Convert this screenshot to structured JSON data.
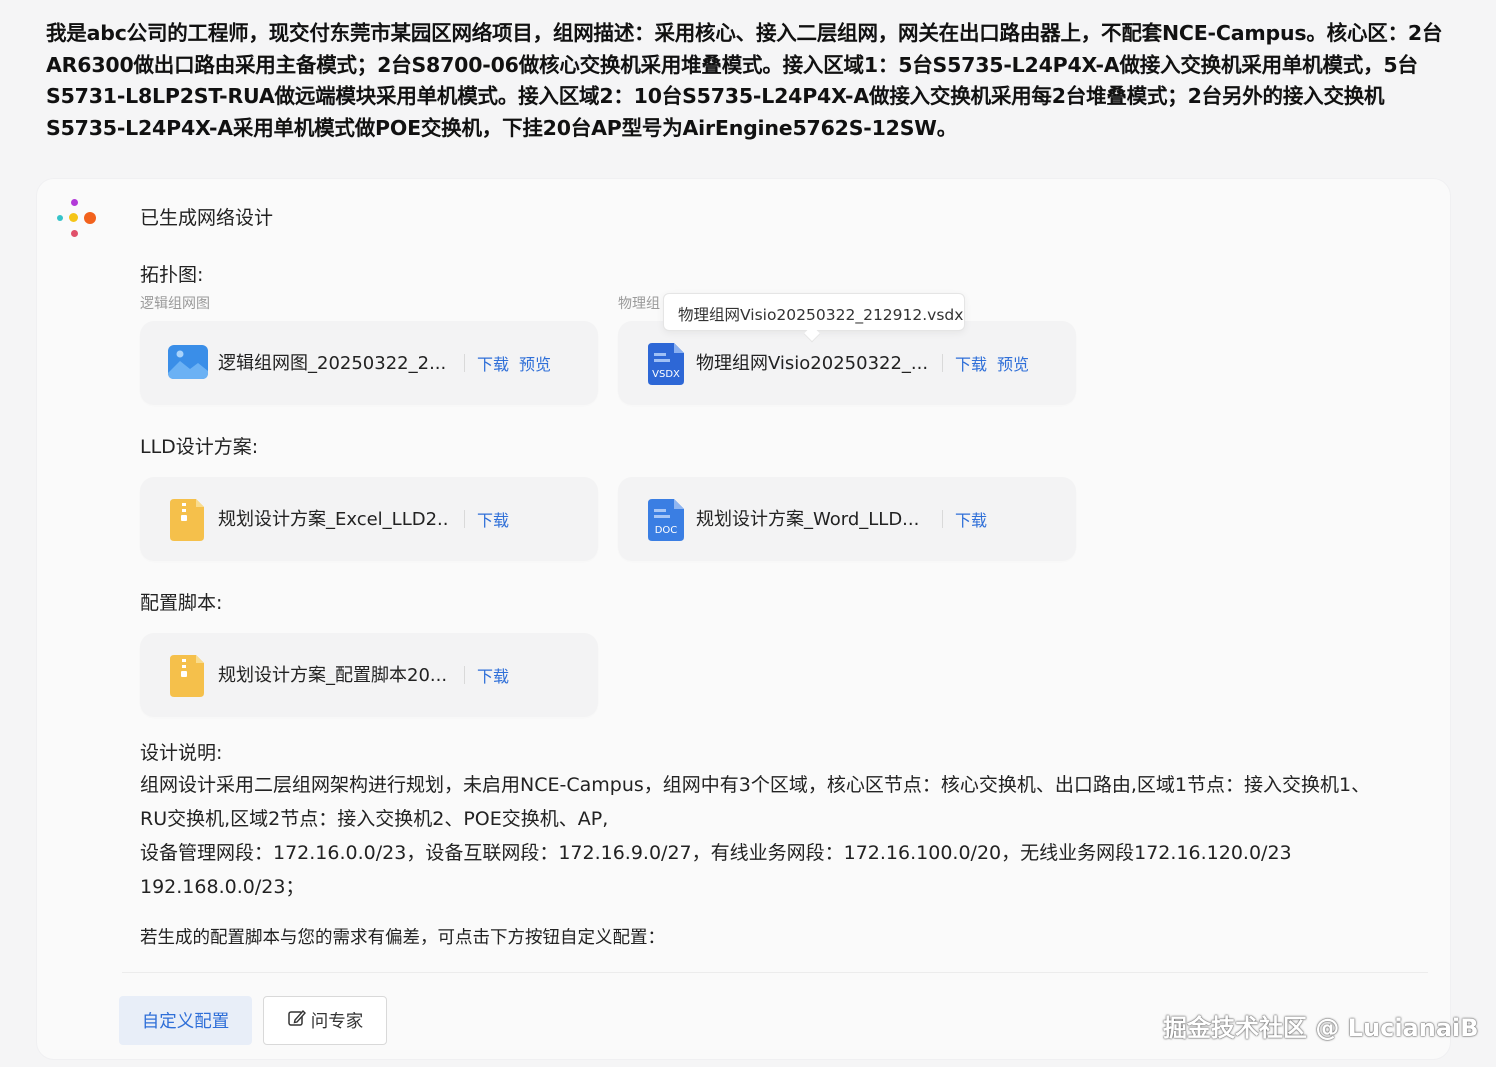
{
  "prompt": "我是abc公司的工程师，现交付东莞市某园区网络项目，组网描述：采用核心、接入二层组网，网关在出口路由器上，不配套NCE-Campus。核心区：2台AR6300做出口路由采用主备模式；2台S8700-06做核心交换机采用堆叠模式。接入区域1：5台S5735-L24P4X-A做接入交换机采用单机模式，5台S5731-L8LP2ST-RUA做远端模块采用单机模式。接入区域2：10台S5735-L24P4X-A做接入交换机采用每2台堆叠模式；2台另外的接入交换机S5735-L24P4X-A采用单机模式做POE交换机，下挂20台AP型号为AirEngine5762S-12SW。",
  "response": {
    "heading": "已生成网络设计",
    "topology": {
      "label": "拓扑图:",
      "logical_sub": "逻辑组网图",
      "physical_sub": "物理组",
      "files": [
        {
          "name": "逻辑组网图_20250322_2...",
          "icon": "image-file-icon",
          "download": "下载",
          "preview": "预览"
        },
        {
          "name": "物理组网Visio20250322_...",
          "icon": "vsdx-file-icon",
          "icon_text": "VSDX",
          "download": "下载",
          "preview": "预览"
        }
      ],
      "tooltip": "物理组网Visio20250322_212912.vsdx"
    },
    "lld": {
      "label": "LLD设计方案:",
      "files": [
        {
          "name": "规划设计方案_Excel_LLD2...",
          "icon": "zip-file-icon",
          "download": "下载"
        },
        {
          "name": "规划设计方案_Word_LLD...",
          "icon": "doc-file-icon",
          "icon_text": "DOC",
          "download": "下载"
        }
      ]
    },
    "script": {
      "label": "配置脚本:",
      "files": [
        {
          "name": "规划设计方案_配置脚本20...",
          "icon": "zip-file-icon",
          "download": "下载"
        }
      ]
    },
    "design": {
      "label": "设计说明:",
      "line1": "组网设计采用二层组网架构进行规划，未启用NCE-Campus，组网中有3个区域，核心区节点：核心交换机、出口路由,区域1节点：接入交换机1、",
      "line2": "RU交换机,区域2节点：接入交换机2、POE交换机、AP,",
      "line3": "设备管理网段：172.16.0.0/23，设备互联网段：172.16.9.0/27，有线业务网段：172.16.100.0/20，无线业务网段172.16.120.0/23",
      "line4": "192.168.0.0/23；"
    },
    "note": "若生成的配置脚本与您的需求有偏差，可点击下方按钮自定义配置：",
    "buttons": {
      "custom": "自定义配置",
      "expert": "问专家"
    }
  },
  "watermark": "掘金技术社区 @ LucianaiB",
  "colors": {
    "link": "#2f6fd8",
    "primary_btn_bg": "#e8eef8",
    "card_bg": "#f3f3f4"
  }
}
